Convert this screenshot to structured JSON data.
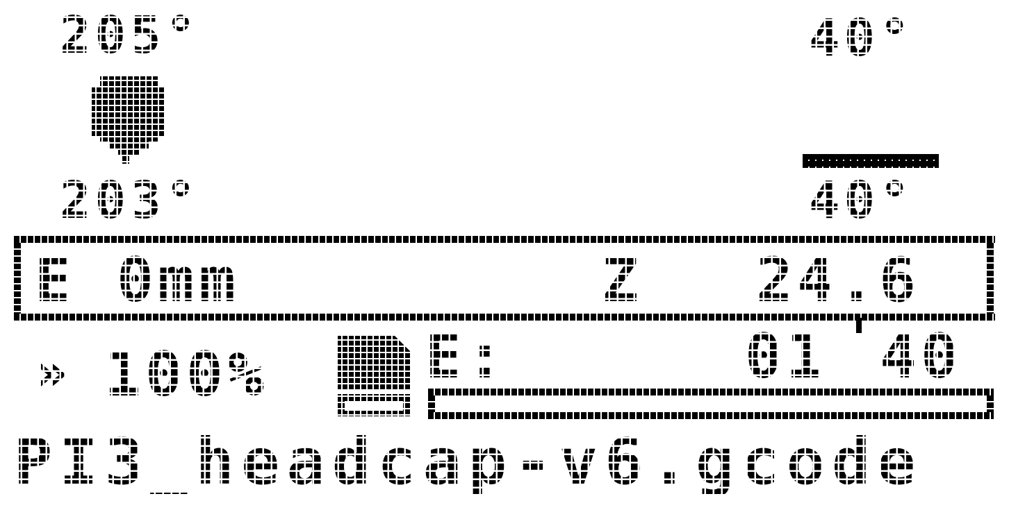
{
  "hotend": {
    "target": "205°",
    "current": "203°",
    "icon": "nozzle-icon"
  },
  "bed": {
    "target": "40°",
    "current": "40°",
    "icon": "bed-icon"
  },
  "status_bar": {
    "e_label": "E",
    "e_value": "0mm",
    "z_label": "Z",
    "z_value": "24.6"
  },
  "feedrate": {
    "icon": "feedrate-arrows-icon",
    "value": "100%"
  },
  "print": {
    "sd_icon": "sd-card-icon",
    "elapsed_label": "E:",
    "elapsed_hours": "01",
    "elapsed_minutes": "40",
    "progress": 0.0
  },
  "filename": "PI3_headcap-v6.gcode"
}
